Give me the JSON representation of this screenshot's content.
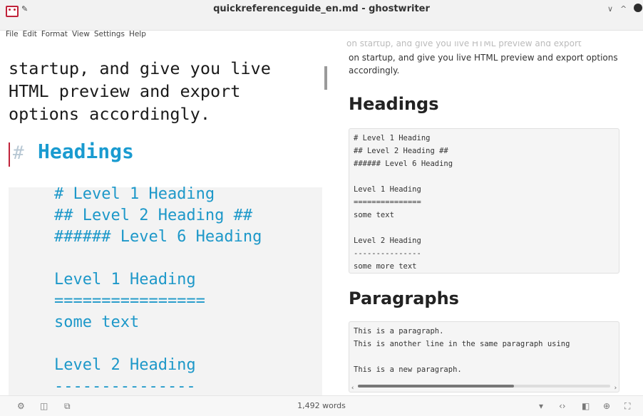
{
  "window": {
    "title": "quickreferenceguide_en.md - ghostwriter",
    "min_symbol": "∨",
    "max_symbol": "^"
  },
  "menu": [
    "File",
    "Edit",
    "Format",
    "View",
    "Settings",
    "Help"
  ],
  "editor": {
    "text_lines": [
      "startup, and give you live",
      "HTML preview and export",
      "options accordingly."
    ],
    "heading_marker": "#",
    "heading": "Headings",
    "code_lines": [
      "# Level 1 Heading",
      "## Level 2 Heading ##",
      "###### Level 6 Heading",
      "",
      "Level 1 Heading",
      "================",
      "some text",
      "",
      "Level 2 Heading",
      "---------------"
    ]
  },
  "preview": {
    "fragment": "on startup, and give you live HTML preview and export",
    "paragraph": "on startup, and give you live HTML preview and export options accordingly.",
    "heading1": "Headings",
    "code1": [
      "# Level 1 Heading",
      "## Level 2 Heading ##",
      "###### Level 6 Heading",
      "",
      "Level 1 Heading",
      "===============",
      "some text",
      "",
      "Level 2 Heading",
      "---------------",
      "some more text"
    ],
    "heading2": "Paragraphs",
    "code2": [
      "This is a paragraph.",
      "This is another line in the same paragraph using",
      "",
      "This is a new paragraph."
    ]
  },
  "statusbar": {
    "word_count": "1,492 words"
  },
  "colors": {
    "accent": "#1a9bd0",
    "caret": "#c0233a"
  }
}
